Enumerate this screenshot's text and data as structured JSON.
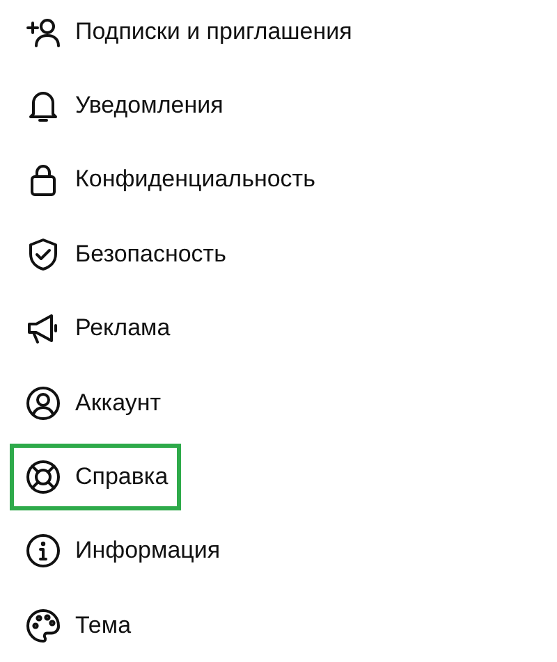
{
  "menu": {
    "items": [
      {
        "label": "Подписки и приглашения",
        "highlighted": false
      },
      {
        "label": "Уведомления",
        "highlighted": false
      },
      {
        "label": "Конфиденциальность",
        "highlighted": false
      },
      {
        "label": "Безопасность",
        "highlighted": false
      },
      {
        "label": "Реклама",
        "highlighted": false
      },
      {
        "label": "Аккаунт",
        "highlighted": false
      },
      {
        "label": "Справка",
        "highlighted": true
      },
      {
        "label": "Информация",
        "highlighted": false
      },
      {
        "label": "Тема",
        "highlighted": false
      }
    ]
  }
}
